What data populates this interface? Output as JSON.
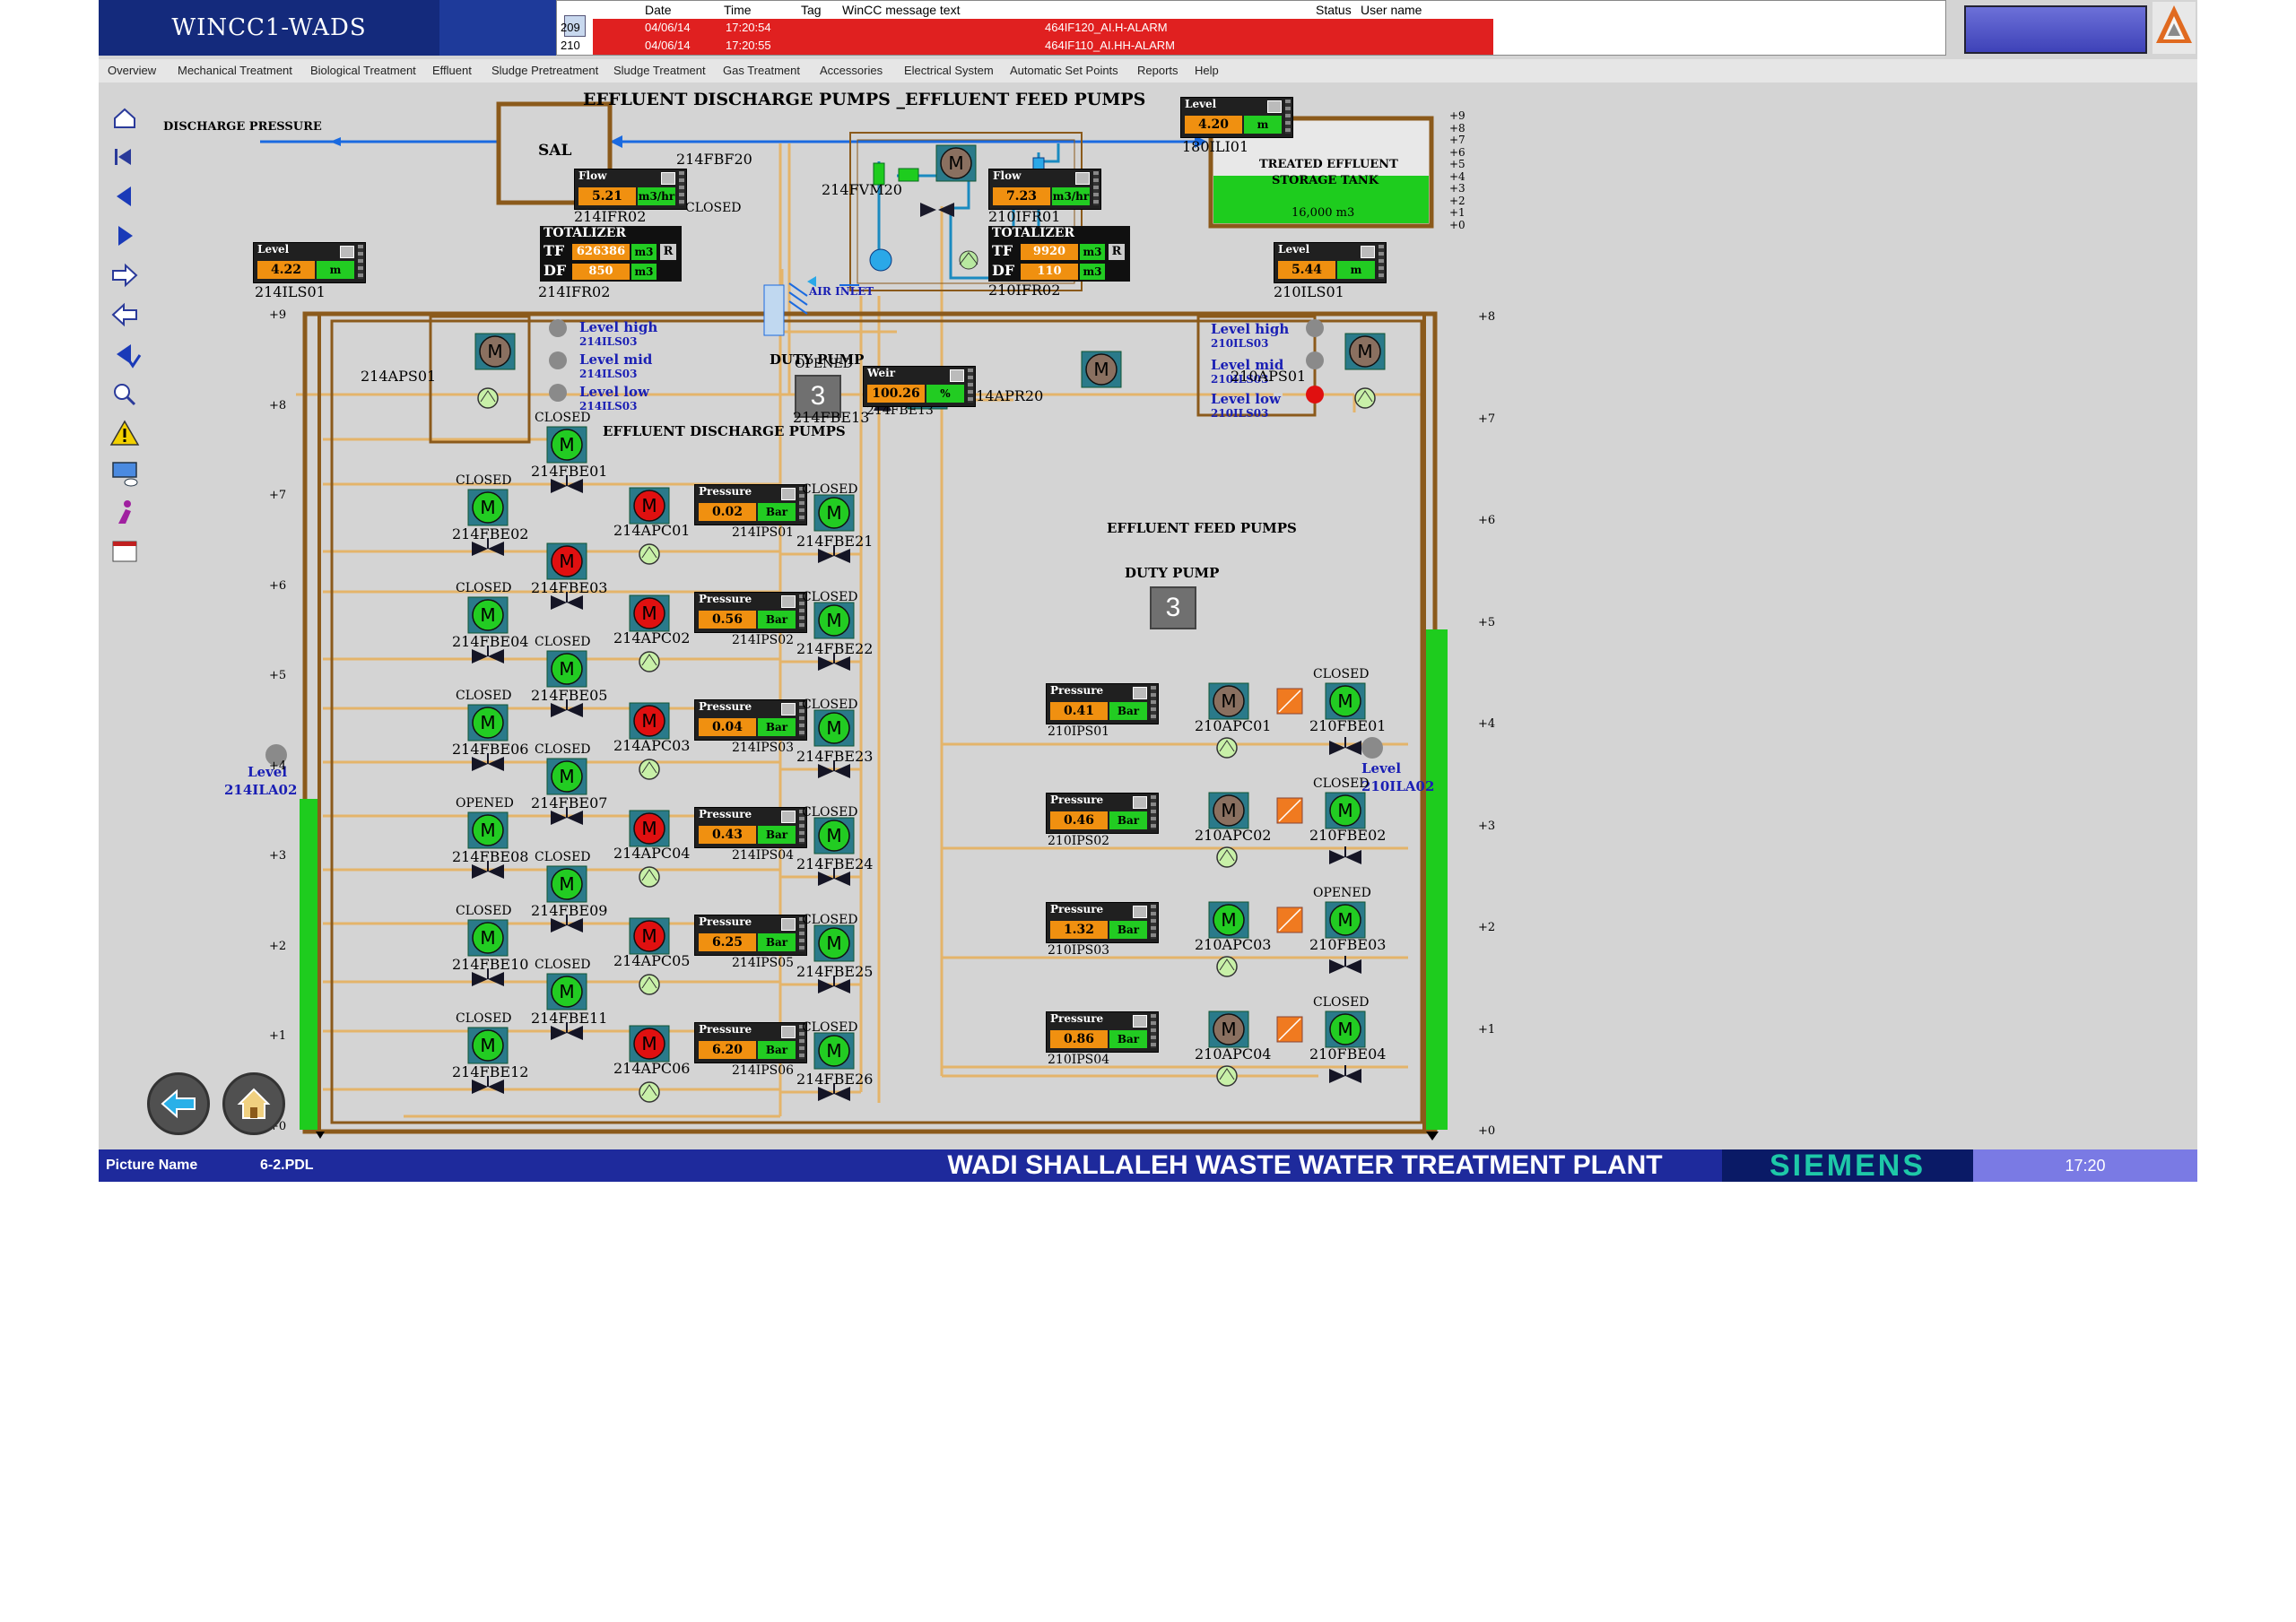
{
  "app": {
    "title": "WINCC1-WADS"
  },
  "alarms": {
    "headers": {
      "date": "Date",
      "time": "Time",
      "tag": "Tag",
      "message": "WinCC message text",
      "status": "Status",
      "user": "User name"
    },
    "rows": [
      {
        "num": "209",
        "date": "04/06/14",
        "time": "17:20:54",
        "message": "464IF120_AI.H-ALARM"
      },
      {
        "num": "210",
        "date": "04/06/14",
        "time": "17:20:55",
        "message": "464IF110_AI.HH-ALARM"
      }
    ]
  },
  "menu": [
    "Overview",
    "Mechanical Treatment",
    "Biological Treatment",
    "Effluent",
    "Sludge Pretreatment",
    "Sludge Treatment",
    "Gas Treatment",
    "Accessories",
    "Electrical System",
    "Automatic Set Points",
    "Reports",
    "Help"
  ],
  "page_title": "EFFLUENT DISCHARGE PUMPS _EFFLUENT FEED PUMPS",
  "labels": {
    "discharge_pressure": "DISCHARGE PRESSURE",
    "sal": "SAL",
    "treated_tank": "TREATED EFFLUENT",
    "storage_tank": "STORAGE TANK",
    "tank_volume": "16,000 m3",
    "air_inlet": "AIR INLET",
    "effluent_discharge_pumps": "EFFLUENT DISCHARGE PUMPS",
    "effluent_feed_pumps": "EFFLUENT FEED PUMPS",
    "duty_pump": "DUTY PUMP",
    "level_high": "Level high",
    "level_mid": "Level mid",
    "level_low": "Level low",
    "level": "Level",
    "closed": "CLOSED",
    "opened": "OPENED"
  },
  "tags": {
    "fbf20": "214FBF20",
    "fvm20": "214FVM20",
    "ifr02_left": "214IFR02",
    "ifr02_tot_left": "214IFR02",
    "ifr01_right": "210IFR01",
    "ifr02_tot_right": "210IFR02",
    "ili01": "180ILI01",
    "ils01_left": "214ILS01",
    "ils01_right": "210ILS01",
    "aps01_left": "214APS01",
    "aps01_right": "210APS01",
    "ils03_l1": "214ILS03",
    "ils03_l2": "214ILS03",
    "ils03_l3": "214ILS03",
    "ils03_r1": "210ILS03",
    "ils03_r2": "210ILS03",
    "ils03_r3": "210ILS03",
    "fbe13": "214FBE13",
    "fbe13b": "214FBE13",
    "apr20": "214APR20",
    "ila02_left": "214ILA02",
    "ila02_right": "210ILA02"
  },
  "meters": {
    "flow_left": {
      "title": "Flow",
      "value": "5.21",
      "unit": "m3/hr"
    },
    "flow_right": {
      "title": "Flow",
      "value": "7.23",
      "unit": "m3/hr"
    },
    "level_tank": {
      "title": "Level",
      "value": "4.20",
      "unit": "m"
    },
    "level_left": {
      "title": "Level",
      "value": "4.22",
      "unit": "m"
    },
    "level_right": {
      "title": "Level",
      "value": "5.44",
      "unit": "m"
    },
    "weir": {
      "title": "Weir",
      "value": "100.26",
      "unit": "%"
    }
  },
  "totalizers": {
    "left": {
      "title": "TOTALIZER",
      "tf": "626386",
      "df": "850",
      "unit": "m3",
      "reset": "R"
    },
    "right": {
      "title": "TOTALIZER",
      "tf": "9920",
      "df": "110",
      "unit": "m3",
      "reset": "R"
    }
  },
  "duty_pumps": {
    "discharge": "3",
    "feed": "3"
  },
  "discharge_pumps": [
    {
      "pump": "214APC01",
      "pressure": "0.02",
      "ps": "214IPS01",
      "valve": "214FBE21"
    },
    {
      "pump": "214APC02",
      "pressure": "0.56",
      "ps": "214IPS02",
      "valve": "214FBE22"
    },
    {
      "pump": "214APC03",
      "pressure": "0.04",
      "ps": "214IPS03",
      "valve": "214FBE23"
    },
    {
      "pump": "214APC04",
      "pressure": "0.43",
      "ps": "214IPS04",
      "valve": "214FBE24"
    },
    {
      "pump": "214APC05",
      "pressure": "6.25",
      "ps": "214IPS05",
      "valve": "214FBE25"
    },
    {
      "pump": "214APC06",
      "pressure": "6.20",
      "ps": "214IPS06",
      "valve": "214FBE26"
    }
  ],
  "left_valves": [
    {
      "tag": "214FBE01",
      "state": "CLOSED"
    },
    {
      "tag": "214FBE02",
      "state": "CLOSED"
    },
    {
      "tag": "214FBE03",
      "state": ""
    },
    {
      "tag": "214FBE04",
      "state": "CLOSED"
    },
    {
      "tag": "214FBE05",
      "state": "CLOSED"
    },
    {
      "tag": "214FBE06",
      "state": "CLOSED"
    },
    {
      "tag": "214FBE07",
      "state": "CLOSED"
    },
    {
      "tag": "214FBE08",
      "state": "OPENED"
    },
    {
      "tag": "214FBE09",
      "state": "CLOSED"
    },
    {
      "tag": "214FBE10",
      "state": "CLOSED"
    },
    {
      "tag": "214FBE11",
      "state": "CLOSED"
    },
    {
      "tag": "214FBE12",
      "state": "CLOSED"
    }
  ],
  "feed_pumps": [
    {
      "pump": "210APC01",
      "pressure": "0.41",
      "ps": "210IPS01",
      "valve": "210FBE01",
      "state": "CLOSED"
    },
    {
      "pump": "210APC02",
      "pressure": "0.46",
      "ps": "210IPS02",
      "valve": "210FBE02",
      "state": "CLOSED"
    },
    {
      "pump": "210APC03",
      "pressure": "1.32",
      "ps": "210IPS03",
      "valve": "210FBE03",
      "state": "OPENED"
    },
    {
      "pump": "210APC04",
      "pressure": "0.86",
      "ps": "210IPS04",
      "valve": "210FBE04",
      "state": "CLOSED"
    }
  ],
  "pressure": {
    "title": "Pressure",
    "unit": "Bar"
  },
  "scales": {
    "left": [
      "+9",
      "+8",
      "+7",
      "+6",
      "+5",
      "+4",
      "+3",
      "+2",
      "+1",
      "+0"
    ],
    "right": [
      "+8",
      "+7",
      "+6",
      "+5",
      "+4",
      "+3",
      "+2",
      "+1",
      "+0"
    ],
    "tank": [
      "+9",
      "+8",
      "+7",
      "+6",
      "+5",
      "+4",
      "+3",
      "+2",
      "+1",
      "+0"
    ]
  },
  "tank_levels": {
    "left_fraction": 0.41,
    "right_fraction": 0.62
  },
  "motor_symbol": "M",
  "footer": {
    "picture_name_label": "Picture Name",
    "picture_name_value": "6-2.PDL",
    "plant_title": "WADI SHALLALEH WASTE WATER TREATMENT PLANT",
    "brand": "SIEMENS",
    "clock": "17:20"
  },
  "colors": {
    "pipe": "#e4b46a",
    "vessel": "#8b5a1b",
    "motor_green": "#22cc22",
    "motor_red": "#e01010",
    "motor_gray": "#8a7060",
    "water": "#1ecc1e",
    "line_blue": "#1a6ae0"
  }
}
